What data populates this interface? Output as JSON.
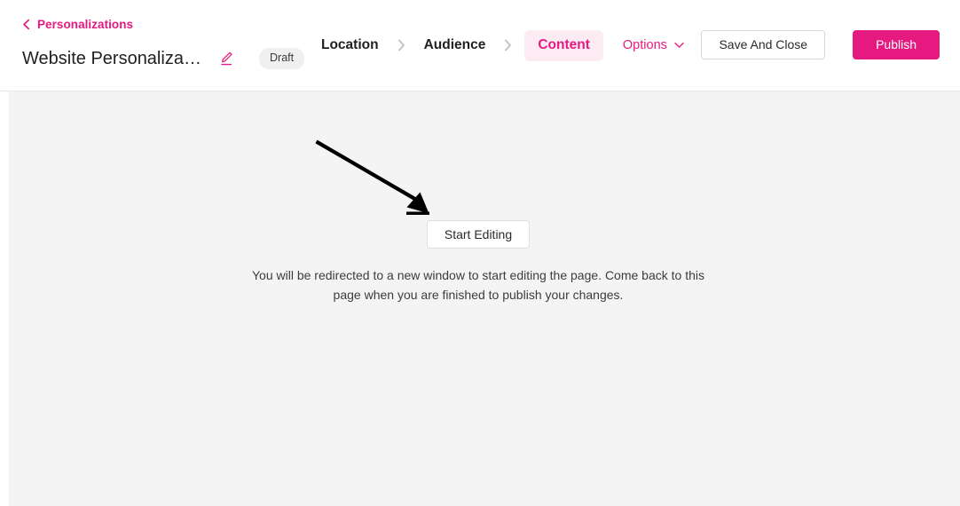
{
  "header": {
    "back_link": {
      "label": "Personalizations",
      "icon": "chevron-left-icon"
    },
    "title": "Website Personalizatio...",
    "edit_icon": "pencil-edit-icon",
    "status_badge": "Draft",
    "steps": [
      {
        "label": "Location",
        "active": false
      },
      {
        "label": "Audience",
        "active": false
      },
      {
        "label": "Content",
        "active": true
      }
    ],
    "step_separator_icon": "chevron-right-icon",
    "options": {
      "label": "Options",
      "icon": "chevron-down-icon"
    },
    "actions": {
      "save_and_close": "Save And Close",
      "publish": "Publish"
    }
  },
  "main": {
    "start_editing_button": "Start Editing",
    "helper_text": "You will be redirected to a new window to start editing the page. Come back to this page when you are finished to publish your changes.",
    "annotation_icon": "arrow-pointer-annotation"
  },
  "colors": {
    "accent_pink": "#e5197f",
    "accent_pink_soft": "#fdebf3",
    "body_background": "#f4f4f4",
    "header_background": "#ffffff",
    "badge_background": "#f0f0f0",
    "text_primary": "#1f1f1f",
    "border": "#e6e6e6"
  }
}
